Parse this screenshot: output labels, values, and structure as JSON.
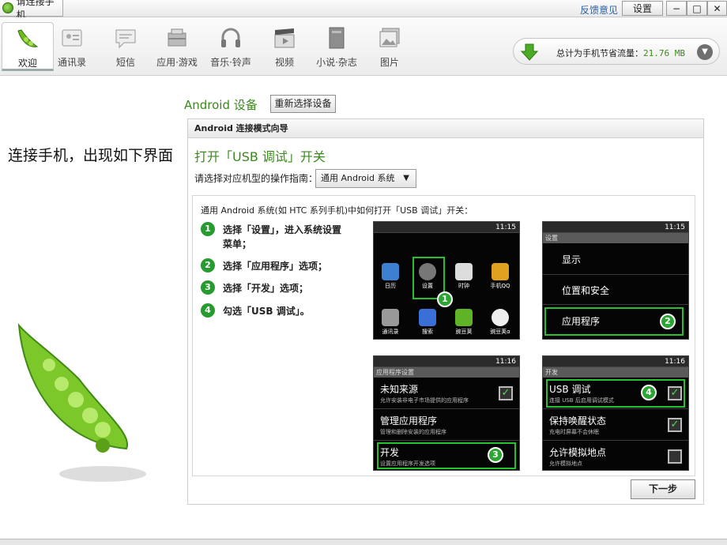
{
  "window": {
    "title": "请连接手机",
    "feedback": "反馈意见",
    "settings": "设置",
    "min": "−",
    "max": "□",
    "close": "✕"
  },
  "nav": [
    {
      "label": "欢迎",
      "icon": "pea-icon"
    },
    {
      "label": "通讯录",
      "icon": "contacts-icon"
    },
    {
      "label": "短信",
      "icon": "sms-icon"
    },
    {
      "label": "应用·游戏",
      "icon": "apps-icon"
    },
    {
      "label": "音乐·铃声",
      "icon": "headphones-icon"
    },
    {
      "label": "视频",
      "icon": "video-icon"
    },
    {
      "label": "小说·杂志",
      "icon": "book-icon"
    },
    {
      "label": "图片",
      "icon": "photo-icon"
    }
  ],
  "savings": {
    "label": "总计为手机节省流量：",
    "value": "21.76 MB"
  },
  "welcome_text": "连接手机，出现如下界面",
  "device": {
    "label": "Android 设备",
    "reselect": "重新选择设备"
  },
  "panel": {
    "header": "Android 连接模式向导",
    "title": "打开「USB 调试」开关",
    "guide_label": "请选择对应机型的操作指南：",
    "model_value": "通用 Android 系统",
    "intro": "通用 Android 系统(如 HTC 系列手机)中如何打开「USB 调试」开关：",
    "steps": [
      {
        "n": "1",
        "text": "选择「设置」，进入系统设置菜单；"
      },
      {
        "n": "2",
        "text": "选择「应用程序」选项；"
      },
      {
        "n": "3",
        "text": "选择「开发」选项；"
      },
      {
        "n": "4",
        "text": "勾选「USB 调试」。"
      }
    ],
    "next": "下一步"
  },
  "shots": {
    "s1": {
      "time": "11:15",
      "apps": [
        "日历",
        "设置",
        "时钟",
        "手机QQ",
        "通讯录",
        "搜索",
        "豌豆荚",
        "豌豆荚α"
      ]
    },
    "s2": {
      "time": "11:15",
      "title": "设置",
      "items": [
        "显示",
        "位置和安全",
        "应用程序"
      ]
    },
    "s3": {
      "time": "11:16",
      "title": "应用程序设置",
      "items": [
        {
          "t": "未知来源",
          "d": "允许安装非电子市场提供的应用程序"
        },
        {
          "t": "管理应用程序",
          "d": "管理和删除安装的应用程序"
        },
        {
          "t": "开发",
          "d": "设置应用程序开发选项"
        }
      ]
    },
    "s4": {
      "time": "11:16",
      "title": "开发",
      "items": [
        {
          "t": "USB 调试",
          "d": "连接 USB 后启用调试模式"
        },
        {
          "t": "保持唤醒状态",
          "d": "充电时屏幕不会休眠"
        },
        {
          "t": "允许模拟地点",
          "d": "允许模拟地点"
        }
      ]
    }
  }
}
